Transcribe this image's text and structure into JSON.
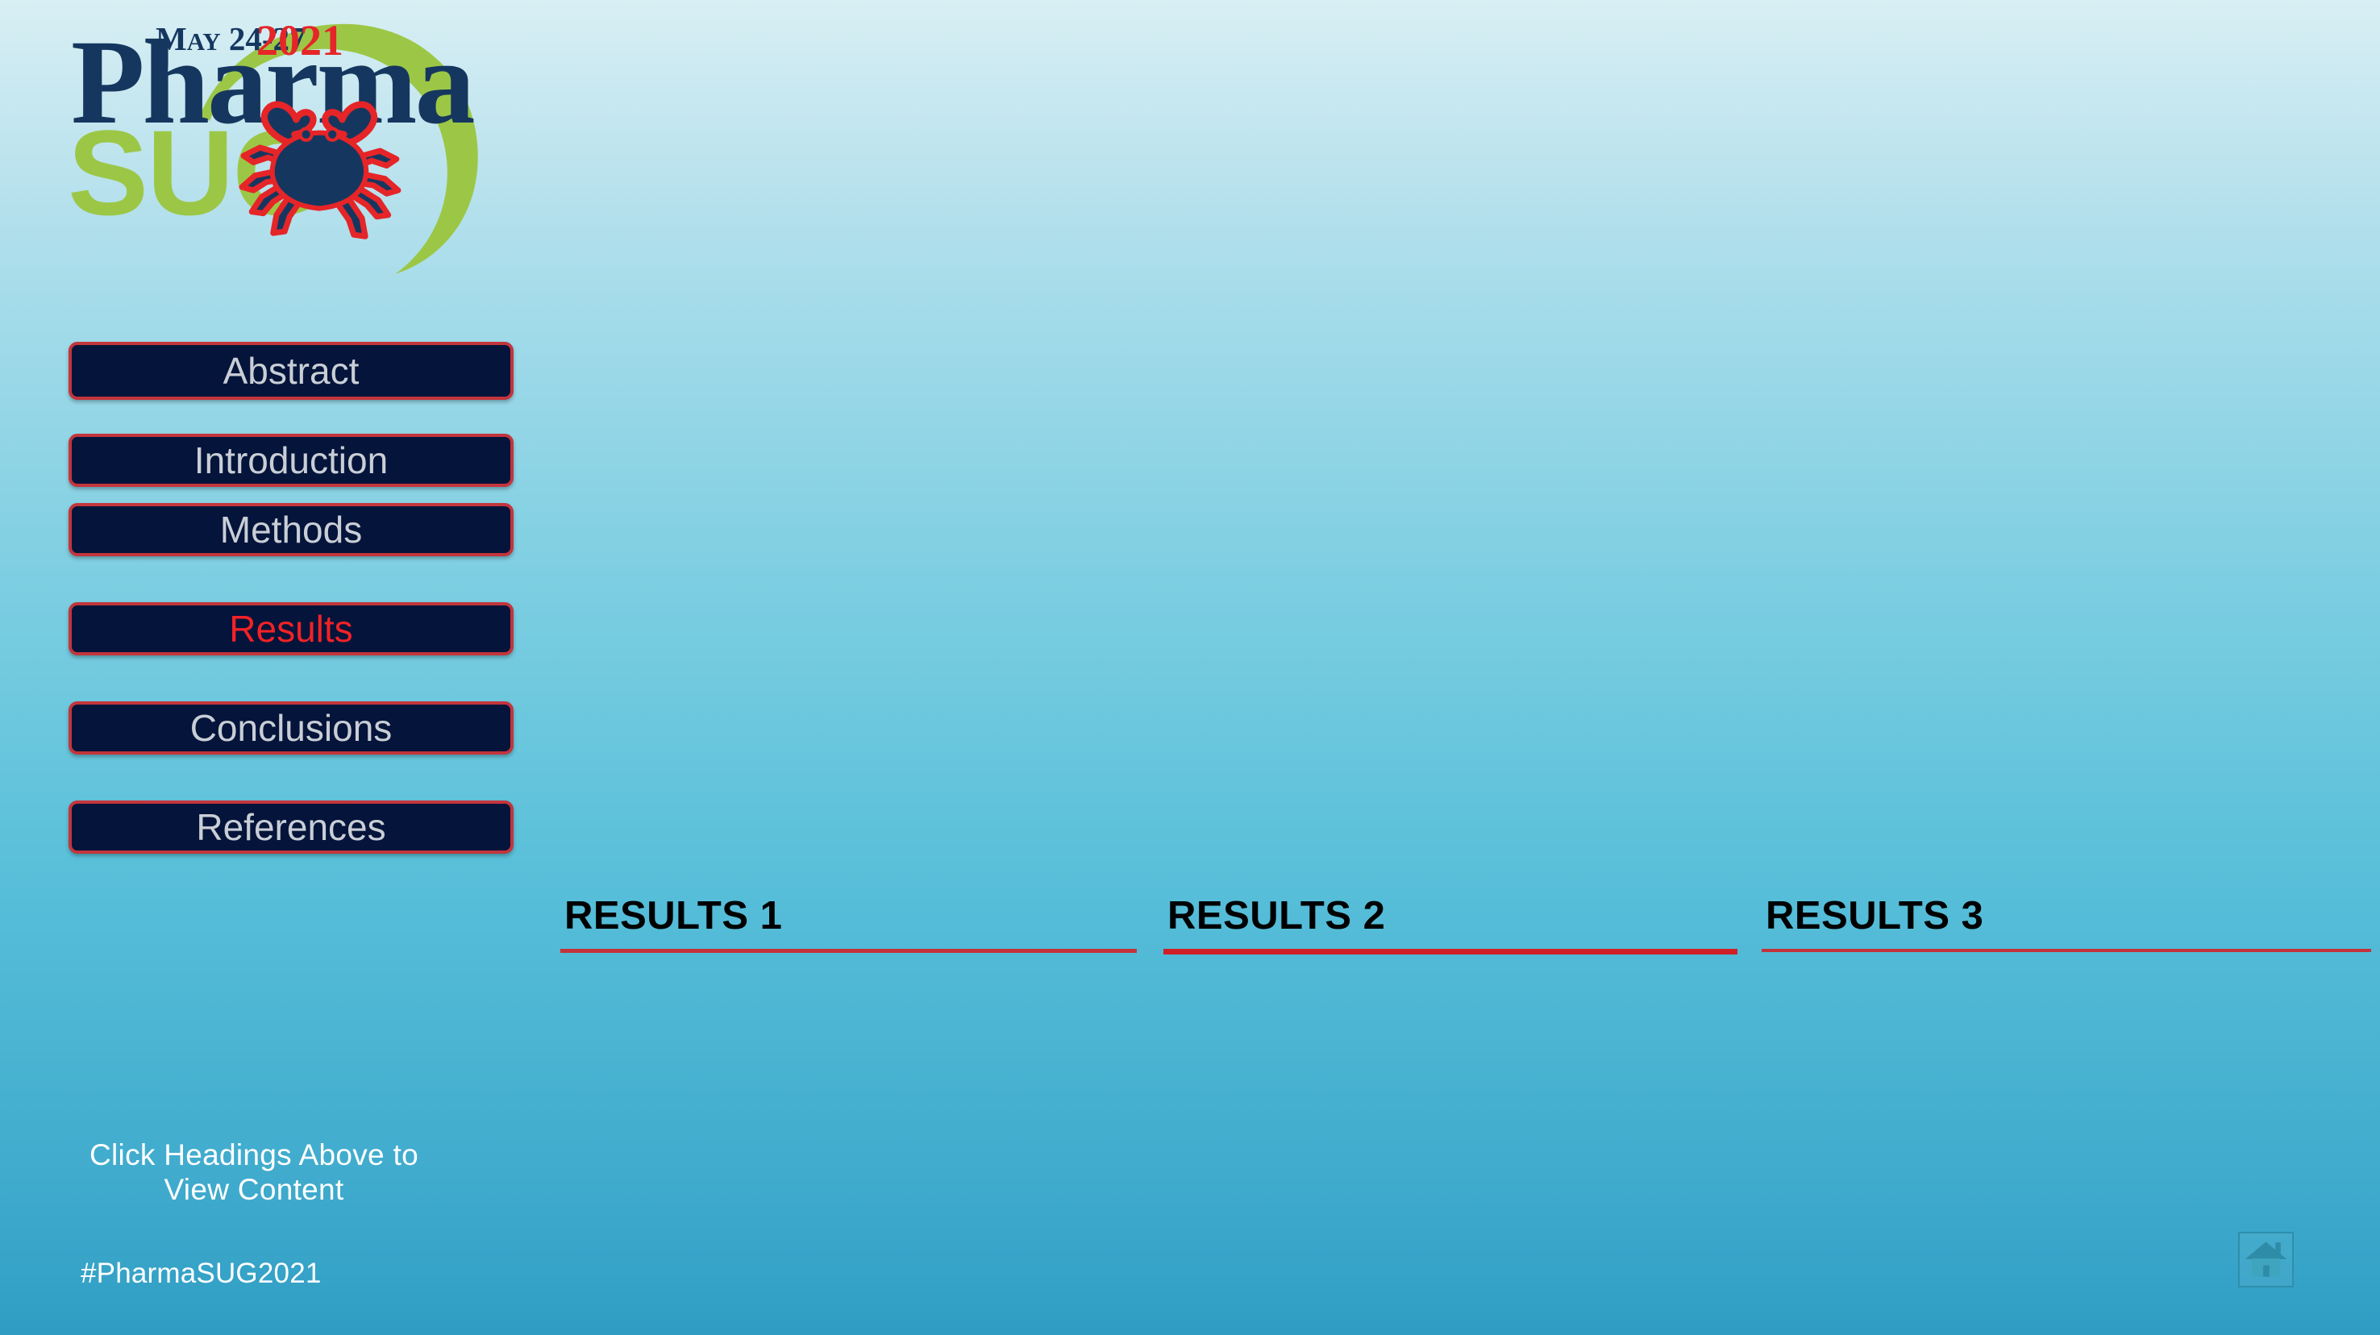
{
  "slide": {
    "background_top_color": "#d8eff4",
    "background_bottom_color": "#2f9cc3"
  },
  "logo": {
    "date_text": "MAY 24-27",
    "year_text": "2021",
    "word_top": "Pharma",
    "word_bottom": "SUG",
    "navy_color": "#15375f",
    "green_color": "#9cc746",
    "red_color": "#e52528",
    "icon": "crab-icon"
  },
  "sidebar": {
    "items": [
      {
        "label": "Abstract",
        "active": false
      },
      {
        "label": "Introduction",
        "active": false
      },
      {
        "label": "Methods",
        "active": false
      },
      {
        "label": "Results",
        "active": true
      },
      {
        "label": "Conclusions",
        "active": false
      },
      {
        "label": "References",
        "active": false
      }
    ],
    "button_fill_color": "#04143a",
    "button_border_color": "#c3353c",
    "button_text_color": "#c9ced6",
    "active_text_color": "#f12226",
    "note_line1": "Click Headings Above to",
    "note_line2": "View Content",
    "hashtag": "#PharmaSUG2021"
  },
  "main": {
    "columns": [
      {
        "heading": "RESULTS 1"
      },
      {
        "heading": "RESULTS 2"
      },
      {
        "heading": "RESULTS 3"
      }
    ],
    "heading_color": "#000000",
    "rule_color": "#c4333a"
  },
  "footer": {
    "home_button_label": "home-icon"
  }
}
